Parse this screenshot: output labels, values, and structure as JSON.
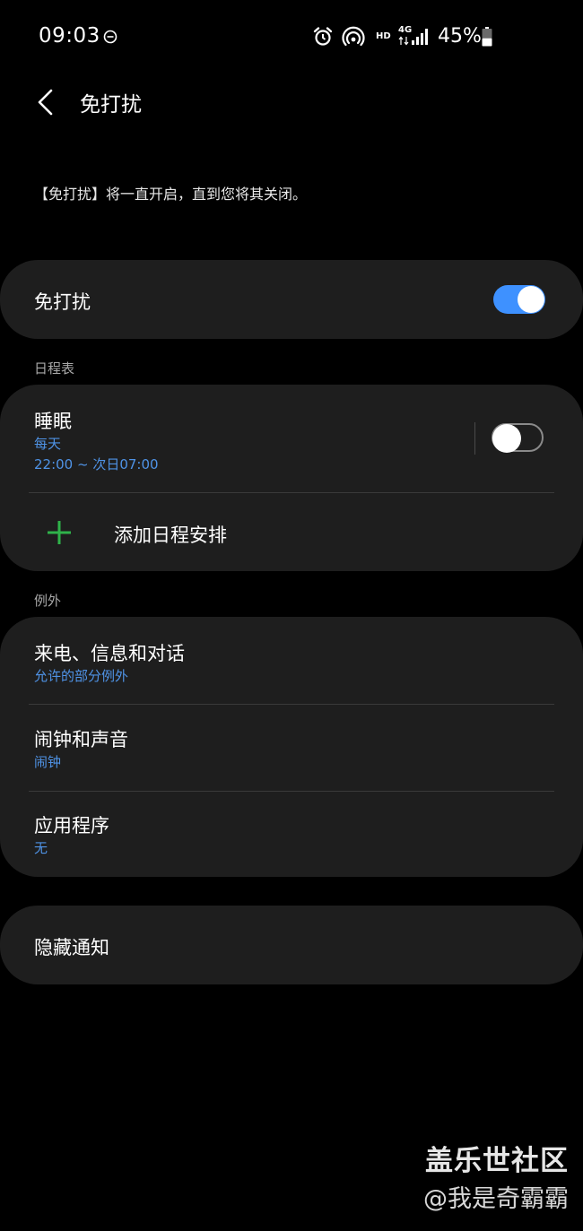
{
  "status_bar": {
    "time": "09:03",
    "network_hd": "HD",
    "network_gen": "4G",
    "battery_percent": "45%",
    "battery_level": 0.45,
    "icons": [
      "dnd-status-icon",
      "alarm-icon",
      "hotspot-icon",
      "data-arrows-icon",
      "signal-icon",
      "battery-icon"
    ]
  },
  "header": {
    "back_icon": "chevron-left-icon",
    "title": "免打扰"
  },
  "description": "【免打扰】将一直开启，直到您将其关闭。",
  "dnd_toggle": {
    "label": "免打扰",
    "on": true
  },
  "schedule": {
    "section_label": "日程表",
    "sleep": {
      "title": "睡眠",
      "days": "每天",
      "time_range": "22:00 ~ 次日07:00",
      "on": false
    },
    "add": {
      "icon": "plus-icon",
      "label": "添加日程安排"
    }
  },
  "exceptions": {
    "section_label": "例外",
    "items": [
      {
        "title": "来电、信息和对话",
        "subtitle": "允许的部分例外"
      },
      {
        "title": "闹钟和声音",
        "subtitle": "闹钟"
      },
      {
        "title": "应用程序",
        "subtitle": "无"
      }
    ]
  },
  "hide_notifications": {
    "label": "隐藏通知"
  },
  "watermark": {
    "line1": "盖乐世社区",
    "line2": "@我是奇霸霸"
  },
  "colors": {
    "background": "#000000",
    "card": "#1e1e1e",
    "accent_blue": "#3e91ff",
    "subtitle_blue": "#4f93e6",
    "plus_green": "#2fb34a"
  }
}
